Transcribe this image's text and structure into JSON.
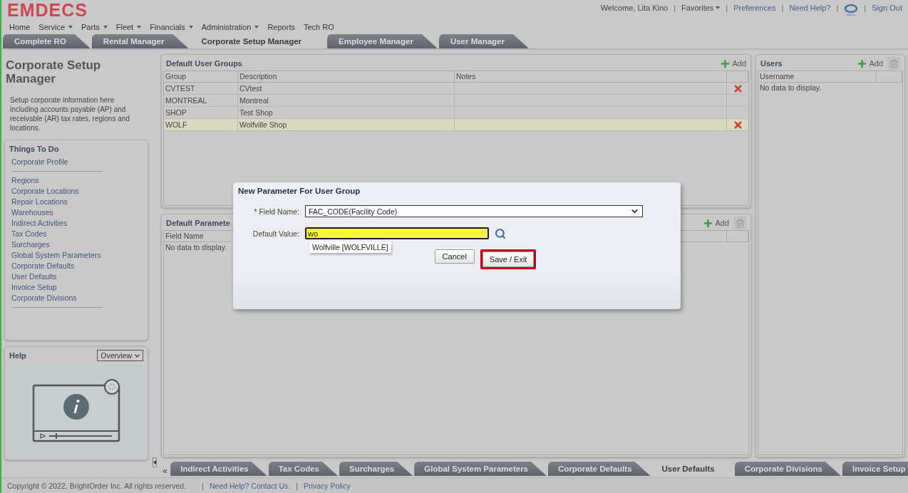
{
  "header": {
    "logo": "EMDECS",
    "separator": "|",
    "user_links": [
      {
        "kind": "text",
        "label": "Welcome, Lita Kino"
      },
      {
        "kind": "menu",
        "label": "Favorites"
      },
      {
        "kind": "link",
        "label": "Preferences"
      },
      {
        "kind": "link",
        "label": "Need Help?"
      },
      {
        "kind": "chat"
      },
      {
        "kind": "link",
        "label": "Sign Out"
      }
    ]
  },
  "nav": [
    {
      "label": "Home",
      "dropdown": false
    },
    {
      "label": "Service",
      "dropdown": true
    },
    {
      "label": "Parts",
      "dropdown": true
    },
    {
      "label": "Fleet",
      "dropdown": true
    },
    {
      "label": "Financials",
      "dropdown": true
    },
    {
      "label": "Administration",
      "dropdown": true
    },
    {
      "label": "Reports",
      "dropdown": false
    },
    {
      "label": "Tech RO",
      "dropdown": false
    }
  ],
  "top_tabs": [
    {
      "label": "Complete RO",
      "selected": false
    },
    {
      "label": "Rental Manager",
      "selected": false
    },
    {
      "label": "Corporate Setup Manager",
      "selected": true
    },
    {
      "label": "Employee Manager",
      "selected": false
    },
    {
      "label": "User Manager",
      "selected": false
    }
  ],
  "sidebar": {
    "title": "Corporate Setup Manager",
    "description": "Setup corporate information here including accounts payable (AP) and receivable (AR) tax rates, regions and locations.",
    "todo": {
      "title": "Things To Do",
      "groups": [
        [
          "Corporate Profile"
        ],
        [
          "Regions",
          "Corporate Locations",
          "Repair Locations",
          "Warehouses",
          "Indirect Activities",
          "Tax Codes",
          "Surcharges",
          "Global System Parameters",
          "Corporate Defaults",
          "User Defaults",
          "Invoice Setup",
          "Corporate Divisions"
        ]
      ]
    },
    "help": {
      "title": "Help",
      "select": "Overview"
    }
  },
  "user_groups": {
    "title": "Default User Groups",
    "add": "Add",
    "columns": [
      "Group",
      "Description",
      "Notes"
    ],
    "rows": [
      {
        "cells": [
          "CVTEST",
          "CVtest",
          ""
        ],
        "deletable": true,
        "selected": false
      },
      {
        "cells": [
          "MONTREAL",
          "Montreal",
          ""
        ],
        "deletable": false,
        "selected": false
      },
      {
        "cells": [
          "SHOP",
          "Test Shop",
          ""
        ],
        "deletable": false,
        "selected": false
      },
      {
        "cells": [
          "WOLF",
          "Wolfville Shop",
          ""
        ],
        "deletable": true,
        "selected": true
      }
    ]
  },
  "parameters": {
    "title": "Default Paramete",
    "add": "Add",
    "columns": [
      "Field Name"
    ],
    "empty": "No data to display."
  },
  "users": {
    "title": "Users",
    "add": "Add",
    "columns": [
      "Username"
    ],
    "empty": "No data to display."
  },
  "bottom_tabs": [
    {
      "label": "Indirect Activities",
      "selected": false
    },
    {
      "label": "Tax Codes",
      "selected": false
    },
    {
      "label": "Surcharges",
      "selected": false
    },
    {
      "label": "Global System Parameters",
      "selected": false
    },
    {
      "label": "Corporate Defaults",
      "selected": false
    },
    {
      "label": "User Defaults",
      "selected": true
    },
    {
      "label": "Corporate Divisions",
      "selected": false
    },
    {
      "label": "Invoice Setup",
      "selected": false
    }
  ],
  "scroll_left": "«",
  "footer": {
    "separator": "|",
    "copyright": "Copyright © 2022, BrightOrder Inc. All rights reserved.",
    "links": [
      "Need Help? Contact Us.",
      "Privacy Policy"
    ]
  },
  "dialog": {
    "title": "New Parameter For User Group",
    "fields": [
      {
        "kind": "select",
        "label": "* Field Name:",
        "value": "FAC_CODE(Facility Code)"
      },
      {
        "kind": "lookup",
        "label": "Default Value:",
        "value": "wo",
        "suggestions": [
          "Wolfville [WOLFVILLE]"
        ]
      }
    ],
    "buttons": [
      {
        "label": "Cancel",
        "focused": false
      },
      {
        "label": "Save / Exit",
        "focused": true
      }
    ]
  }
}
